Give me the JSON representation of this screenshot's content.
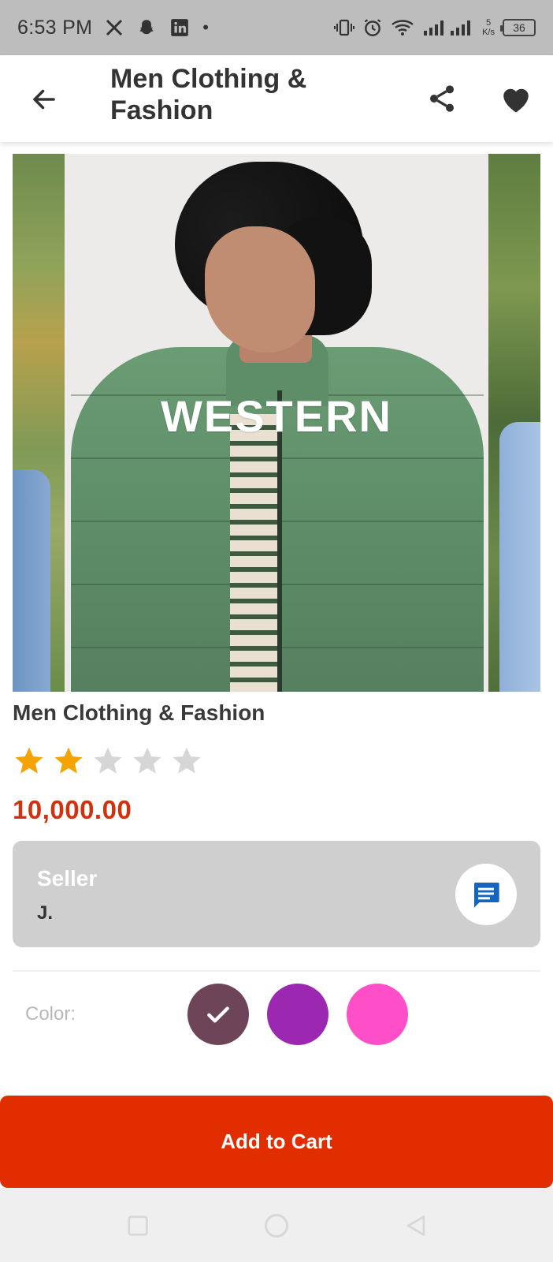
{
  "status_bar": {
    "time": "6:53 PM",
    "speed_value": "5",
    "speed_unit": "K/s",
    "battery": "36",
    "dot": "•"
  },
  "app_bar": {
    "title": "Men Clothing & Fashion",
    "icons": {
      "back": "arrow-left-icon",
      "share": "share-icon",
      "favorite": "heart-icon"
    }
  },
  "carousel": {
    "overlay_text": "WESTERN"
  },
  "product": {
    "title": "Men Clothing & Fashion",
    "rating": 2,
    "rating_max": 5,
    "price": "10,000.00",
    "price_color": "#d0310f"
  },
  "seller": {
    "label": "Seller",
    "name": "J.",
    "chat_icon": "chat-icon"
  },
  "colors": {
    "label": "Color:",
    "options": [
      {
        "hex": "#6e4458",
        "selected": true
      },
      {
        "hex": "#9c27b0",
        "selected": false
      },
      {
        "hex": "#ff4fc8",
        "selected": false
      }
    ]
  },
  "cart": {
    "label": "Add to Cart",
    "color": "#e12d00"
  },
  "system_nav": {
    "icons": [
      "recents-icon",
      "home-icon",
      "back-triangle-icon"
    ]
  }
}
